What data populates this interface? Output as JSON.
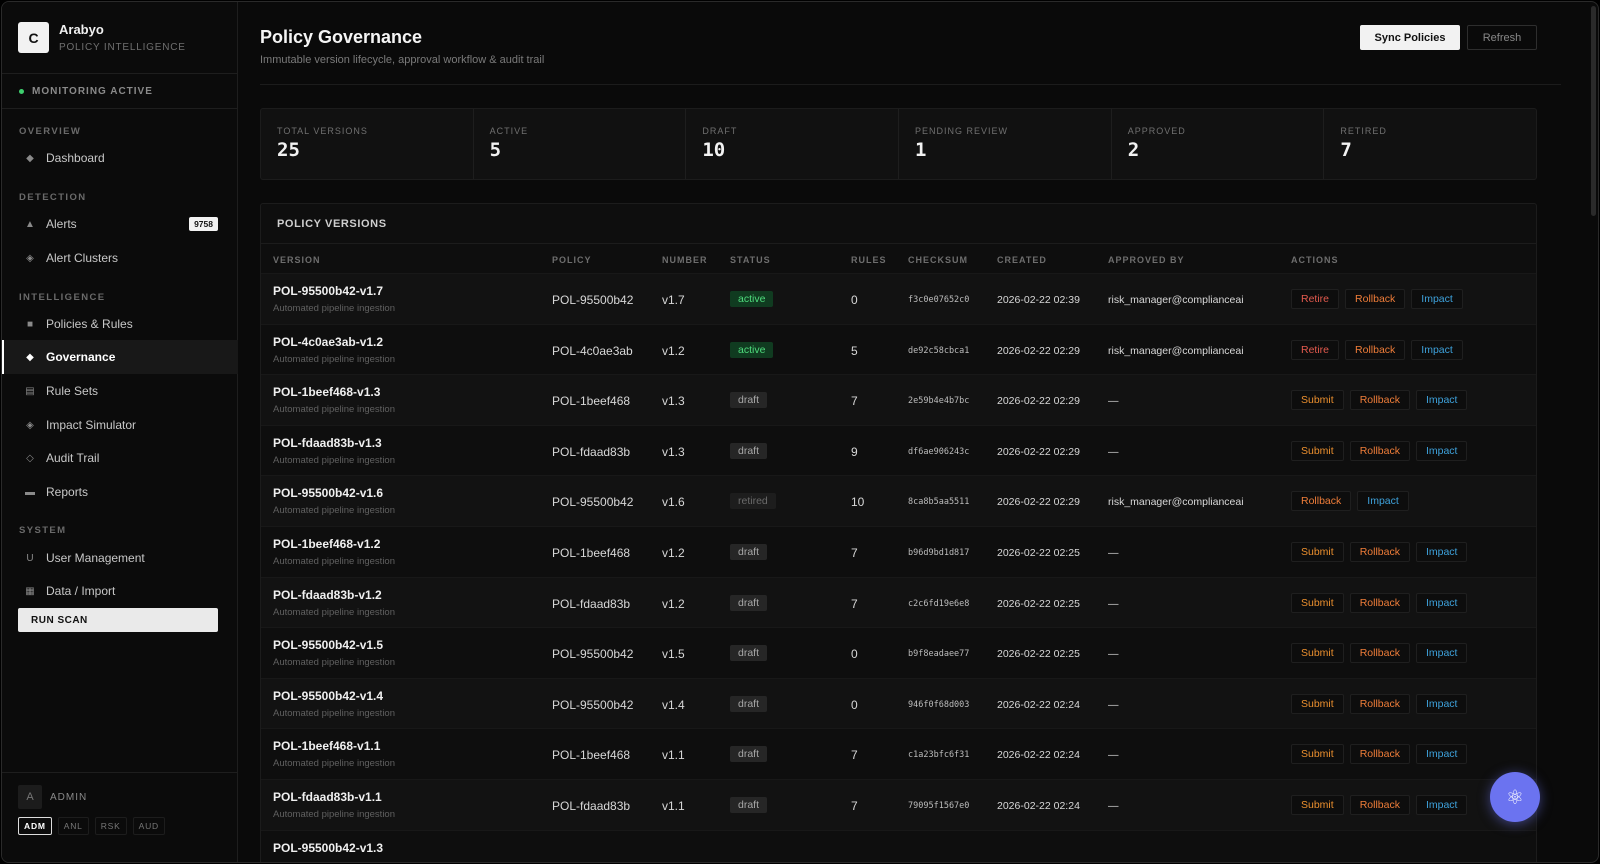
{
  "brand": {
    "logo": "C",
    "name": "Arabyo",
    "sub": "POLICY INTELLIGENCE"
  },
  "monitor": "MONITORING ACTIVE",
  "sections": {
    "overview": "OVERVIEW",
    "detection": "DETECTION",
    "intelligence": "INTELLIGENCE",
    "system": "SYSTEM"
  },
  "nav": {
    "dashboard": "Dashboard",
    "alerts": "Alerts",
    "alerts_badge": "9758",
    "alert_clusters": "Alert Clusters",
    "policies": "Policies & Rules",
    "governance": "Governance",
    "rule_sets": "Rule Sets",
    "impact_sim": "Impact Simulator",
    "audit": "Audit Trail",
    "reports": "Reports",
    "users": "User Management",
    "data_import": "Data / Import",
    "run_scan": "RUN SCAN"
  },
  "user": {
    "avatar": "A",
    "name": "ADMIN",
    "roles": [
      "ADM",
      "ANL",
      "RSK",
      "AUD"
    ]
  },
  "page": {
    "title": "Policy Governance",
    "subtitle": "Immutable version lifecycle, approval workflow & audit trail",
    "sync_label": "Sync Policies",
    "refresh_label": "Refresh"
  },
  "stats": [
    {
      "label": "TOTAL VERSIONS",
      "value": "25"
    },
    {
      "label": "ACTIVE",
      "value": "5"
    },
    {
      "label": "DRAFT",
      "value": "10"
    },
    {
      "label": "PENDING REVIEW",
      "value": "1"
    },
    {
      "label": "APPROVED",
      "value": "2"
    },
    {
      "label": "RETIRED",
      "value": "7"
    }
  ],
  "table": {
    "title": "POLICY VERSIONS",
    "headers": [
      "VERSION",
      "POLICY",
      "NUMBER",
      "STATUS",
      "RULES",
      "CHECKSUM",
      "CREATED",
      "APPROVED BY",
      "ACTIONS"
    ],
    "rows": [
      {
        "version": "POL-95500b42-v1.7",
        "desc": "Automated pipeline ingestion",
        "policy": "POL-95500b42",
        "number": "v1.7",
        "status": "active",
        "rules": "0",
        "checksum": "f3c0e07652c0",
        "created": "2026-02-22 02:39",
        "approved_by": "risk_manager@complianceai",
        "actions": [
          "Retire",
          "Rollback",
          "Impact"
        ]
      },
      {
        "version": "POL-4c0ae3ab-v1.2",
        "desc": "Automated pipeline ingestion",
        "policy": "POL-4c0ae3ab",
        "number": "v1.2",
        "status": "active",
        "rules": "5",
        "checksum": "de92c58cbca1",
        "created": "2026-02-22 02:29",
        "approved_by": "risk_manager@complianceai",
        "actions": [
          "Retire",
          "Rollback",
          "Impact"
        ]
      },
      {
        "version": "POL-1beef468-v1.3",
        "desc": "Automated pipeline ingestion",
        "policy": "POL-1beef468",
        "number": "v1.3",
        "status": "draft",
        "rules": "7",
        "checksum": "2e59b4e4b7bc",
        "created": "2026-02-22 02:29",
        "approved_by": "—",
        "actions": [
          "Submit",
          "Rollback",
          "Impact"
        ]
      },
      {
        "version": "POL-fdaad83b-v1.3",
        "desc": "Automated pipeline ingestion",
        "policy": "POL-fdaad83b",
        "number": "v1.3",
        "status": "draft",
        "rules": "9",
        "checksum": "df6ae906243c",
        "created": "2026-02-22 02:29",
        "approved_by": "—",
        "actions": [
          "Submit",
          "Rollback",
          "Impact"
        ]
      },
      {
        "version": "POL-95500b42-v1.6",
        "desc": "Automated pipeline ingestion",
        "policy": "POL-95500b42",
        "number": "v1.6",
        "status": "retired",
        "rules": "10",
        "checksum": "8ca8b5aa5511",
        "created": "2026-02-22 02:29",
        "approved_by": "risk_manager@complianceai",
        "actions": [
          "Rollback",
          "Impact"
        ]
      },
      {
        "version": "POL-1beef468-v1.2",
        "desc": "Automated pipeline ingestion",
        "policy": "POL-1beef468",
        "number": "v1.2",
        "status": "draft",
        "rules": "7",
        "checksum": "b96d9bd1d817",
        "created": "2026-02-22 02:25",
        "approved_by": "—",
        "actions": [
          "Submit",
          "Rollback",
          "Impact"
        ]
      },
      {
        "version": "POL-fdaad83b-v1.2",
        "desc": "Automated pipeline ingestion",
        "policy": "POL-fdaad83b",
        "number": "v1.2",
        "status": "draft",
        "rules": "7",
        "checksum": "c2c6fd19e6e8",
        "created": "2026-02-22 02:25",
        "approved_by": "—",
        "actions": [
          "Submit",
          "Rollback",
          "Impact"
        ]
      },
      {
        "version": "POL-95500b42-v1.5",
        "desc": "Automated pipeline ingestion",
        "policy": "POL-95500b42",
        "number": "v1.5",
        "status": "draft",
        "rules": "0",
        "checksum": "b9f8eadaee77",
        "created": "2026-02-22 02:25",
        "approved_by": "—",
        "actions": [
          "Submit",
          "Rollback",
          "Impact"
        ]
      },
      {
        "version": "POL-95500b42-v1.4",
        "desc": "Automated pipeline ingestion",
        "policy": "POL-95500b42",
        "number": "v1.4",
        "status": "draft",
        "rules": "0",
        "checksum": "946f0f68d003",
        "created": "2026-02-22 02:24",
        "approved_by": "—",
        "actions": [
          "Submit",
          "Rollback",
          "Impact"
        ]
      },
      {
        "version": "POL-1beef468-v1.1",
        "desc": "Automated pipeline ingestion",
        "policy": "POL-1beef468",
        "number": "v1.1",
        "status": "draft",
        "rules": "7",
        "checksum": "c1a23bfc6f31",
        "created": "2026-02-22 02:24",
        "approved_by": "—",
        "actions": [
          "Submit",
          "Rollback",
          "Impact"
        ]
      },
      {
        "version": "POL-fdaad83b-v1.1",
        "desc": "Automated pipeline ingestion",
        "policy": "POL-fdaad83b",
        "number": "v1.1",
        "status": "draft",
        "rules": "7",
        "checksum": "79095f1567e0",
        "created": "2026-02-22 02:24",
        "approved_by": "—",
        "actions": [
          "Submit",
          "Rollback",
          "Impact"
        ]
      },
      {
        "version": "POL-95500b42-v1.3",
        "desc": "",
        "policy": "",
        "number": "",
        "status": "",
        "rules": "",
        "checksum": "",
        "created": "",
        "approved_by": "",
        "actions": []
      }
    ]
  },
  "fab_icon": "atom-icon"
}
